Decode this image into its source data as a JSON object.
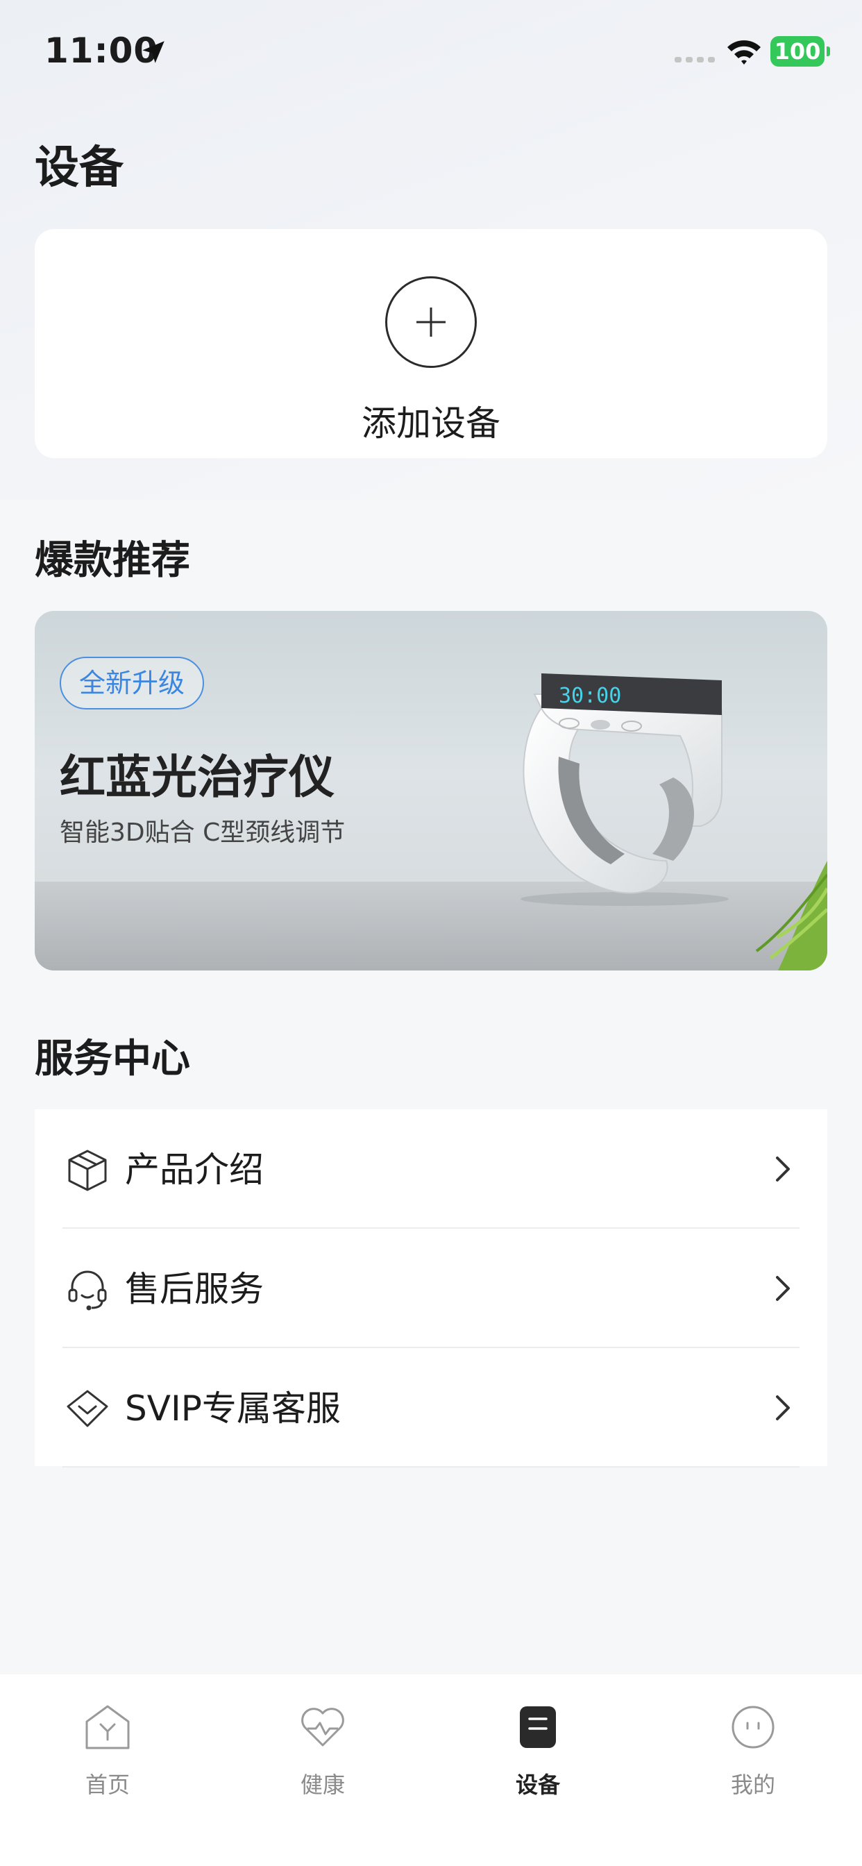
{
  "status_bar": {
    "time": "11:00",
    "battery": "100"
  },
  "page": {
    "title": "设备"
  },
  "add_device": {
    "label": "添加设备"
  },
  "featured": {
    "section_title": "爆款推荐",
    "badge": "全新升级",
    "title": "红蓝光治疗仪",
    "subtitle": "智能3D贴合 C型颈线调节"
  },
  "service_center": {
    "section_title": "服务中心",
    "items": [
      {
        "label": "产品介绍",
        "icon": "box-icon"
      },
      {
        "label": "售后服务",
        "icon": "headset-icon"
      },
      {
        "label": "SVIP专属客服",
        "icon": "diamond-icon"
      }
    ]
  },
  "tab_bar": {
    "tabs": [
      {
        "label": "首页",
        "icon": "home-icon"
      },
      {
        "label": "健康",
        "icon": "heart-icon"
      },
      {
        "label": "设备",
        "icon": "device-icon",
        "active": true
      },
      {
        "label": "我的",
        "icon": "profile-icon"
      }
    ]
  },
  "colors": {
    "accent_blue": "#3a86e0",
    "battery_green": "#34c759"
  }
}
